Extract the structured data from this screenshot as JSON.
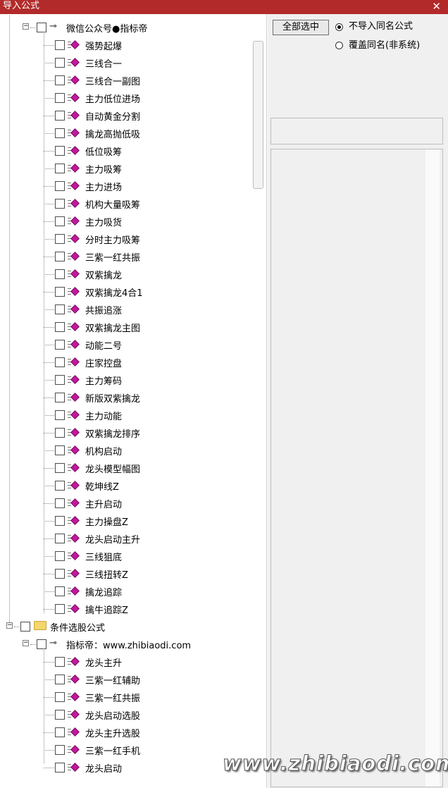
{
  "window": {
    "title": "导入公式",
    "close_glyph": "✕"
  },
  "tree": {
    "group1": {
      "label": "微信公众号●指标帝",
      "expand_glyph": "−",
      "items": [
        "强势起爆",
        "三线合一",
        "三线合一副图",
        "主力低位进场",
        "自动黄金分割",
        "擒龙高抛低吸",
        "低位吸筹",
        "主力吸筹",
        "主力进场",
        "机构大量吸筹",
        "主力吸货",
        "分时主力吸筹",
        "三紫一红共振",
        "双紫擒龙",
        "双紫擒龙4合1",
        "共振追涨",
        "双紫擒龙主图",
        "动能二号",
        "庄家控盘",
        "主力筹码",
        "新版双紫擒龙",
        "主力动能",
        "双紫擒龙排序",
        "机构启动",
        "龙头模型幅图",
        "乾坤线Z",
        "主升启动",
        "主力操盘Z",
        "龙头启动主升",
        "三线狙底",
        "三线扭转Z",
        "擒龙追踪",
        "擒牛追踪Z"
      ]
    },
    "folder": {
      "label": "条件选股公式",
      "expand_glyph": "−"
    },
    "group2": {
      "label": "指标帝：www.zhibiaodi.com",
      "expand_glyph": "−",
      "items": [
        "龙头主升",
        "三紫一红辅助",
        "三紫一红共振",
        "龙头启动选股",
        "龙头主升选股",
        "三紫一红手机",
        "龙头启动"
      ]
    }
  },
  "options": {
    "select_all_label": "全部选中",
    "radio_no_import_label": "不导入同名公式",
    "radio_overwrite_label": "覆盖同名(非系统)",
    "selected": "no_import"
  },
  "watermark": "www.zhibiaodi.com",
  "colors": {
    "titlebar": "#b22a2a",
    "diamond": "#c2189b",
    "folder": "#f3d66c"
  },
  "icons": {
    "key": "key-icon",
    "folder": "folder-icon",
    "formula": "formula-diamond-icon"
  }
}
